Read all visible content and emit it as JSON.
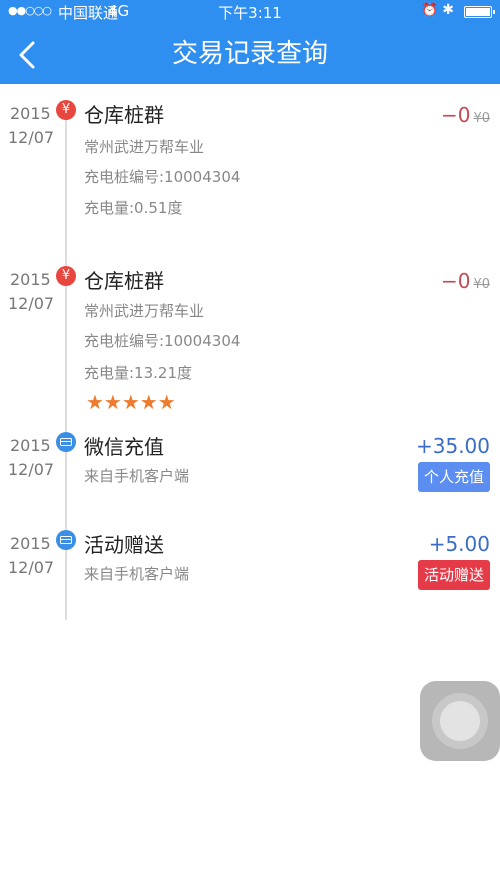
{
  "status_bar": {
    "signal": "●●○○○",
    "carrier": "中国联通",
    "network": "4G",
    "time": "下午3:11"
  },
  "header": {
    "title": "交易记录查询"
  },
  "records": [
    {
      "year": "2015",
      "date": "12/07",
      "icon": "yuan",
      "title": "仓库桩群",
      "location": "常州武进万帮车业",
      "pile_no": "充电桩编号:10004304",
      "energy": "充电量:0.51度",
      "amount": "−0",
      "original": "¥0"
    },
    {
      "year": "2015",
      "date": "12/07",
      "icon": "yuan",
      "title": "仓库桩群",
      "location": "常州武进万帮车业",
      "pile_no": "充电桩编号:10004304",
      "energy": "充电量:13.21度",
      "amount": "−0",
      "original": "¥0",
      "rating": 5,
      "stars": "★★★★★"
    },
    {
      "year": "2015",
      "date": "12/07",
      "icon": "card",
      "title": "微信充值",
      "source": "来自手机客户端",
      "amount": "+35.00",
      "tag": "个人充值",
      "tag_color": "#5b8ef0"
    },
    {
      "year": "2015",
      "date": "12/07",
      "icon": "card",
      "title": "活动赠送",
      "source": "来自手机客户端",
      "amount": "+5.00",
      "tag": "活动赠送",
      "tag_color": "#e53a48"
    }
  ],
  "colors": {
    "header_bg": "#2f8ff0",
    "negative_amount": "#c44a55",
    "positive_amount": "#3a6dc7",
    "star": "#ef7b2e"
  }
}
